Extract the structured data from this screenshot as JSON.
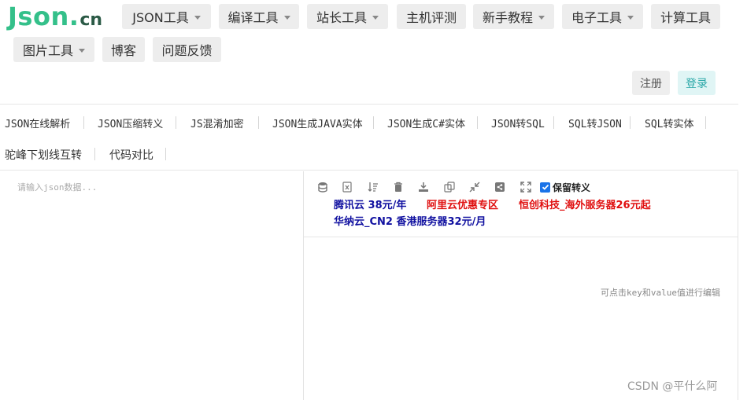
{
  "logo": {
    "main": "Json",
    "dot": ".",
    "cn": "cn"
  },
  "nav": [
    {
      "label": "JSON工具",
      "dropdown": true
    },
    {
      "label": "编译工具",
      "dropdown": true
    },
    {
      "label": "站长工具",
      "dropdown": true
    },
    {
      "label": "主机评测",
      "dropdown": false
    },
    {
      "label": "新手教程",
      "dropdown": true
    },
    {
      "label": "电子工具",
      "dropdown": true
    },
    {
      "label": "计算工具",
      "dropdown": false
    },
    {
      "label": "图片工具",
      "dropdown": true
    },
    {
      "label": "博客",
      "dropdown": false
    },
    {
      "label": "问题反馈",
      "dropdown": false
    }
  ],
  "auth": {
    "register": "注册",
    "login": "登录"
  },
  "tools": [
    "JSON在线解析",
    "JSON压缩转义",
    "JS混淆加密",
    "JSON生成JAVA实体",
    "JSON生成C#实体",
    "JSON转SQL",
    "SQL转JSON",
    "SQL转实体",
    "驼峰下划线互转",
    "代码对比"
  ],
  "editor": {
    "placeholder": "请输入json数据...",
    "keep_escape_label": "保留转义",
    "keep_escape_checked": true,
    "hint": "可点击key和value值进行编辑",
    "icons": [
      "database-icon",
      "excel-icon",
      "sort-icon",
      "trash-icon",
      "download-icon",
      "copy-icon",
      "compress-icon",
      "share-icon",
      "fullscreen-icon"
    ]
  },
  "ads": [
    {
      "text": "腾讯云 38元/年",
      "color": "blue"
    },
    {
      "text": "阿里云优惠专区",
      "color": "red"
    },
    {
      "text": "恒创科技_海外服务器26元起",
      "color": "red"
    },
    {
      "text": "华纳云_CN2 香港服务器32元/月",
      "color": "blue"
    }
  ],
  "watermark": "CSDN @平什么阿",
  "colors": {
    "brand": "#34c08a",
    "accent": "#2aa8a8",
    "ad_blue": "#1010a0",
    "ad_red": "#e01010",
    "checkbox": "#1a73e8"
  }
}
